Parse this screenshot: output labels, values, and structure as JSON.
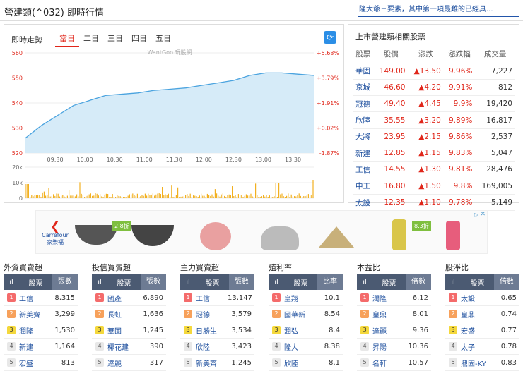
{
  "header": {
    "title": "營建類(^032) 即時行情",
    "news": "隆大爺三要素，其中第一項最難的已經具..."
  },
  "chart": {
    "label": "即時走勢",
    "tabs": [
      "當日",
      "二日",
      "三日",
      "四日",
      "五日"
    ],
    "active_tab": 0,
    "watermark": "WantGoo 玩股網",
    "refresh_icon": "refresh-icon",
    "y_left": [
      "560",
      "550",
      "540",
      "530",
      "520"
    ],
    "y_right": [
      "+5.68%",
      "+3.79%",
      "+1.91%",
      "+0.02%",
      "-1.87%"
    ],
    "x_labels": [
      "09:30",
      "10:00",
      "10:30",
      "11:00",
      "11:30",
      "12:00",
      "12:30",
      "13:00",
      "13:30"
    ],
    "vol_labels": [
      "20k",
      "10k",
      "0"
    ],
    "ref_value": 530,
    "colors": {
      "line": "#4aa3df",
      "fill": "#d6ebf8",
      "volume": "#f2b020",
      "ref": "#999999"
    }
  },
  "chart_data": {
    "type": "line",
    "x": [
      "09:00",
      "09:15",
      "09:30",
      "09:45",
      "10:00",
      "10:15",
      "10:30",
      "10:45",
      "11:00",
      "11:15",
      "11:30",
      "11:45",
      "12:00",
      "12:15",
      "12:30",
      "12:45",
      "13:00",
      "13:15",
      "13:30"
    ],
    "values": [
      526,
      531,
      535,
      539,
      541,
      543,
      543.5,
      544,
      545,
      545.5,
      546,
      547,
      548,
      549,
      551,
      552,
      552,
      551.5,
      551
    ],
    "ylim": [
      520,
      560
    ],
    "volume_ylim": [
      0,
      20000
    ]
  },
  "stocks": {
    "title": "上市營建類相關股票",
    "headers": [
      "股票",
      "股價",
      "漲跌",
      "漲跌幅",
      "成交量"
    ],
    "rows": [
      [
        "華固",
        "149.00",
        "▲13.50",
        "9.96%",
        "7,227"
      ],
      [
        "京城",
        "46.60",
        "▲4.20",
        "9.91%",
        "812"
      ],
      [
        "冠德",
        "49.40",
        "▲4.45",
        "9.9%",
        "19,420"
      ],
      [
        "欣陸",
        "35.55",
        "▲3.20",
        "9.89%",
        "16,817"
      ],
      [
        "大將",
        "23.95",
        "▲2.15",
        "9.86%",
        "2,537"
      ],
      [
        "新建",
        "12.85",
        "▲1.15",
        "9.83%",
        "5,047"
      ],
      [
        "工信",
        "14.55",
        "▲1.30",
        "9.81%",
        "28,476"
      ],
      [
        "中工",
        "16.80",
        "▲1.50",
        "9.8%",
        "169,005"
      ],
      [
        "太設",
        "12.35",
        "▲1.10",
        "9.78%",
        "5,149"
      ]
    ]
  },
  "ad": {
    "brand": "Carrefour 家樂福",
    "tags": [
      "2.8折",
      "8.3折"
    ]
  },
  "rankings": [
    {
      "title": "外資買賣超",
      "col1": "股票",
      "col2": "張數",
      "rows": [
        [
          "工信",
          "8,315"
        ],
        [
          "新美齊",
          "3,299"
        ],
        [
          "潤隆",
          "1,530"
        ],
        [
          "新建",
          "1,164"
        ],
        [
          "宏盛",
          "813"
        ]
      ]
    },
    {
      "title": "投信買賣超",
      "col1": "股票",
      "col2": "張數",
      "rows": [
        [
          "國產",
          "6,890"
        ],
        [
          "長虹",
          "1,636"
        ],
        [
          "華固",
          "1,245"
        ],
        [
          "椰花建",
          "390"
        ],
        [
          "達麗",
          "317"
        ]
      ]
    },
    {
      "title": "主力買賣超",
      "col1": "股票",
      "col2": "張數",
      "rows": [
        [
          "工信",
          "13,147"
        ],
        [
          "冠德",
          "3,579"
        ],
        [
          "日勝生",
          "3,534"
        ],
        [
          "欣陸",
          "3,423"
        ],
        [
          "新美齊",
          "1,245"
        ]
      ]
    },
    {
      "title": "殖利率",
      "col1": "股票",
      "col2": "比率",
      "rows": [
        [
          "皇翔",
          "10.1"
        ],
        [
          "國華新",
          "8.54"
        ],
        [
          "潤弘",
          "8.4"
        ],
        [
          "隆大",
          "8.38"
        ],
        [
          "欣陸",
          "8.1"
        ]
      ]
    },
    {
      "title": "本益比",
      "col1": "股票",
      "col2": "倍數",
      "rows": [
        [
          "潤隆",
          "6.12"
        ],
        [
          "皇鼎",
          "8.01"
        ],
        [
          "達麗",
          "9.36"
        ],
        [
          "昇陽",
          "10.36"
        ],
        [
          "名軒",
          "10.57"
        ]
      ]
    },
    {
      "title": "股淨比",
      "col1": "股票",
      "col2": "倍數",
      "rows": [
        [
          "太設",
          "0.65"
        ],
        [
          "皇鼎",
          "0.74"
        ],
        [
          "宏盛",
          "0.77"
        ],
        [
          "太子",
          "0.78"
        ],
        [
          "鼎固-KY",
          "0.83"
        ]
      ]
    }
  ]
}
